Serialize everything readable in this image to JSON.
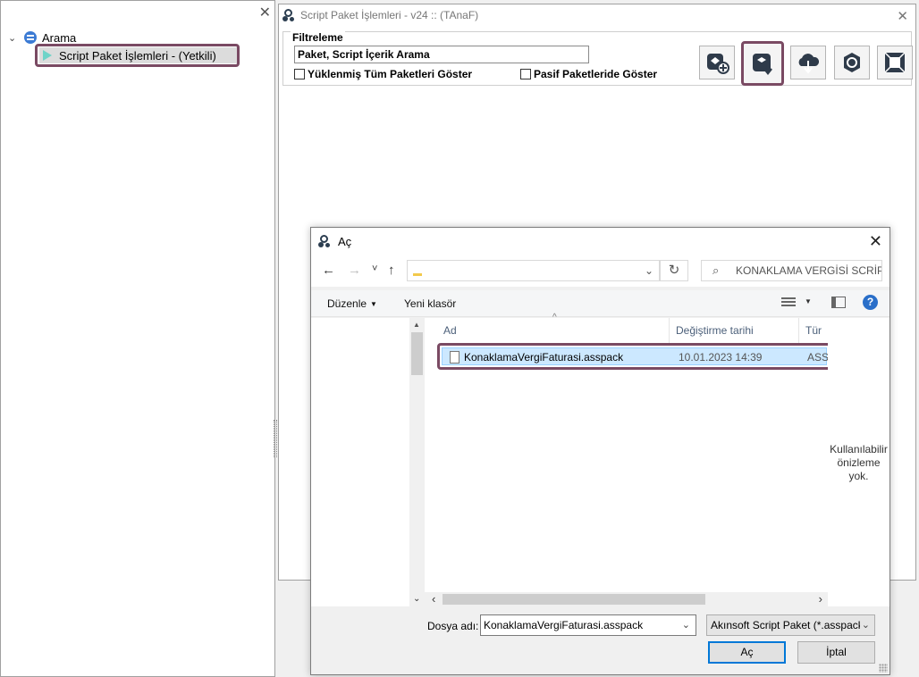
{
  "left_pane": {
    "close_label": "✕",
    "tree_root_label": "Arama",
    "tree_item_label": "Script Paket İşlemleri - (Yetkili)"
  },
  "main_window": {
    "title": "Script Paket İşlemleri - v24 :: (TAnaF)",
    "close_label": "✕",
    "filter": {
      "group_title": "Filtreleme",
      "search_placeholder": "Paket, Script İçerik Arama",
      "checkbox_all_label": "Yüklenmiş Tüm Paketleri Göster",
      "checkbox_passive_label": "Pasif Paketleride Göster"
    },
    "toolbar": {
      "buttons": [
        {
          "icon": "package-add-icon"
        },
        {
          "icon": "package-import-icon",
          "highlighted": true
        },
        {
          "icon": "cloud-download-icon"
        },
        {
          "icon": "refresh-icon"
        },
        {
          "icon": "maximize-icon"
        }
      ]
    }
  },
  "dialog": {
    "title": "Aç",
    "close_label": "✕",
    "nav": {
      "back": "←",
      "forward": "→",
      "recent": "˅",
      "up": "↑",
      "refresh": "↻",
      "search_text": "KONAKLAMA VERGİSİ SCRİP..."
    },
    "commands": {
      "organize": "Düzenle",
      "new_folder": "Yeni klasör",
      "help": "?"
    },
    "columns": {
      "name": "Ad",
      "modified": "Değiştirme tarihi",
      "type": "Tür"
    },
    "files": [
      {
        "name": "KonaklamaVergiFaturasi.asspack",
        "modified": "10.01.2023 14:39",
        "type": "ASSPACK"
      }
    ],
    "preview_text": "Kullanılabilir önizleme yok.",
    "filename_label": "Dosya adı:",
    "filename_value": "KonaklamaVergiFaturasi.asspack",
    "filetype_value": "Akınsoft Script Paket (*.asspack)",
    "open_button": "Aç",
    "cancel_button": "İptal"
  },
  "colors": {
    "highlight_border": "#7a4a63",
    "selection_bg": "#cce8ff",
    "accent": "#0078d7"
  }
}
